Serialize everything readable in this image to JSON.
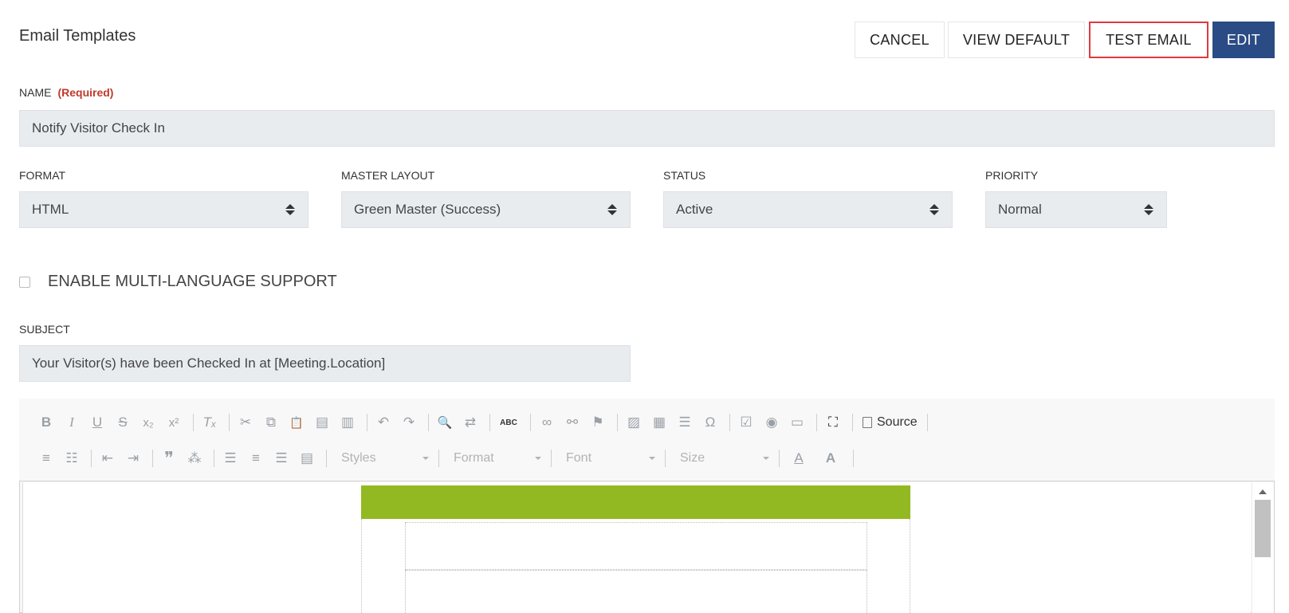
{
  "header": {
    "title": "Email Templates",
    "buttons": {
      "cancel": "CANCEL",
      "view_default": "VIEW DEFAULT",
      "test_email": "TEST EMAIL",
      "edit": "EDIT"
    }
  },
  "name_field": {
    "label": "NAME",
    "required": "(Required)",
    "value": "Notify Visitor Check In"
  },
  "format": {
    "label": "FORMAT",
    "value": "HTML"
  },
  "master_layout": {
    "label": "MASTER LAYOUT",
    "value": "Green Master (Success)"
  },
  "status": {
    "label": "STATUS",
    "value": "Active"
  },
  "priority": {
    "label": "PRIORITY",
    "value": "Normal"
  },
  "multi_language": {
    "label": "ENABLE MULTI-LANGUAGE SUPPORT",
    "checked": false
  },
  "subject": {
    "label": "SUBJECT",
    "value": "Your Visitor(s) have been Checked In at [Meeting.Location]"
  },
  "editor": {
    "row1_icons": [
      "bold-icon",
      "italic-icon",
      "underline-icon",
      "strikethrough-icon",
      "subscript-icon",
      "superscript-icon",
      "remove-format-icon",
      "cut-icon",
      "copy-icon",
      "paste-icon",
      "paste-text-icon",
      "paste-word-icon",
      "undo-icon",
      "redo-icon",
      "find-icon",
      "replace-icon",
      "spellcheck-icon",
      "link-icon",
      "unlink-icon",
      "anchor-icon",
      "image-icon",
      "table-icon",
      "horizontal-line-icon",
      "special-char-icon",
      "checkbox-icon",
      "radio-icon",
      "textfield-icon",
      "maximize-icon"
    ],
    "source_label": "Source",
    "styles_combo": "Styles",
    "format_combo": "Format",
    "font_combo": "Font",
    "size_combo": "Size",
    "glyphs": {
      "bold": "B",
      "italic": "I",
      "underline": "U",
      "strike": "S",
      "sub": "x₂",
      "sup": "x²",
      "clear": "Tₓ",
      "cut": "✂",
      "copy": "⧉",
      "paste": "📋",
      "paste_text": "▤",
      "paste_word": "▥",
      "undo": "↶",
      "redo": "↷",
      "find": "🔍",
      "replace": "⇄",
      "spell": "ABC",
      "link": "∞",
      "unlink": "⚯",
      "anchor": "⚑",
      "image": "▨",
      "table": "▦",
      "hline": "☰",
      "omega": "Ω",
      "checkbox": "☑",
      "radio": "◉",
      "textfield": "▭",
      "maximize": "⛶",
      "numlist": "≡",
      "bullist": "☷",
      "outdent": "⇤",
      "indent": "⇥",
      "blockquote": "❞",
      "div": "⁂",
      "align_left": "☰",
      "align_center": "≡",
      "align_right": "☰",
      "justify": "▤",
      "text_color": "A",
      "bg_color": "A"
    }
  },
  "colors": {
    "accent": "#2b4b84",
    "highlight_border": "#e0393e",
    "required": "#c0392b",
    "layout_green": "#92b921",
    "field_bg": "#e9ecef"
  }
}
